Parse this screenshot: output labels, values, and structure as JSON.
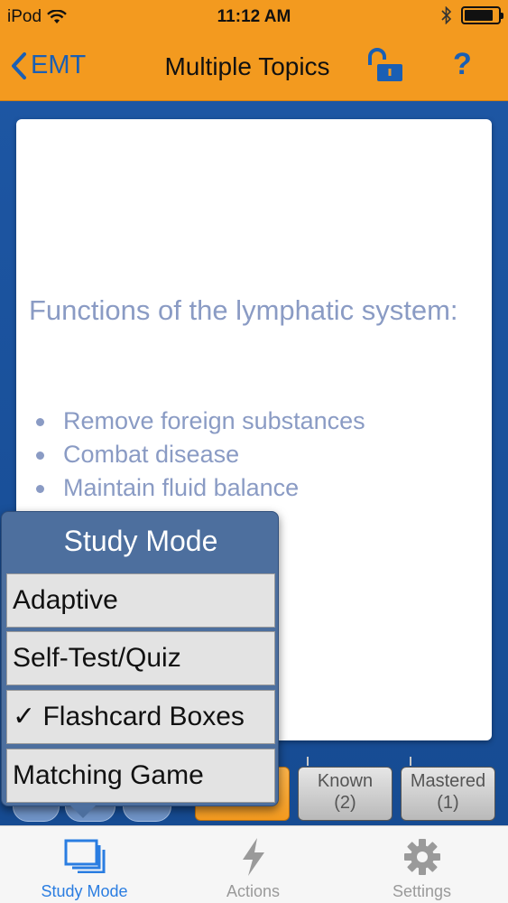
{
  "status": {
    "carrier": "iPod",
    "time": "11:12 AM",
    "battery_level": 0.85
  },
  "nav": {
    "back_label": "EMT",
    "title": "Multiple Topics",
    "help_label": "?"
  },
  "card": {
    "heading": "Functions of the lymphatic system:",
    "bullets": [
      "Remove foreign substances",
      "Combat disease",
      "Maintain fluid balance"
    ]
  },
  "boxes": {
    "known": {
      "label": "Known",
      "count": "(2)"
    },
    "mastered": {
      "label": "Mastered",
      "count": "(1)"
    }
  },
  "popover": {
    "title": "Study Mode",
    "options": [
      "Adaptive",
      "Self-Test/Quiz",
      "✓ Flashcard Boxes",
      "Matching Game"
    ],
    "selected": "Flashcard Boxes"
  },
  "tabs": [
    {
      "label": "Study Mode",
      "icon": "study-mode-icon",
      "active": true
    },
    {
      "label": "Actions",
      "icon": "lightning-icon",
      "active": false
    },
    {
      "label": "Settings",
      "icon": "gear-icon",
      "active": false
    }
  ],
  "colors": {
    "accent_orange": "#f39a1f",
    "accent_blue": "#1a5fb4",
    "stage_blue": "#1b4f97",
    "card_text": "#8a9bc4"
  }
}
